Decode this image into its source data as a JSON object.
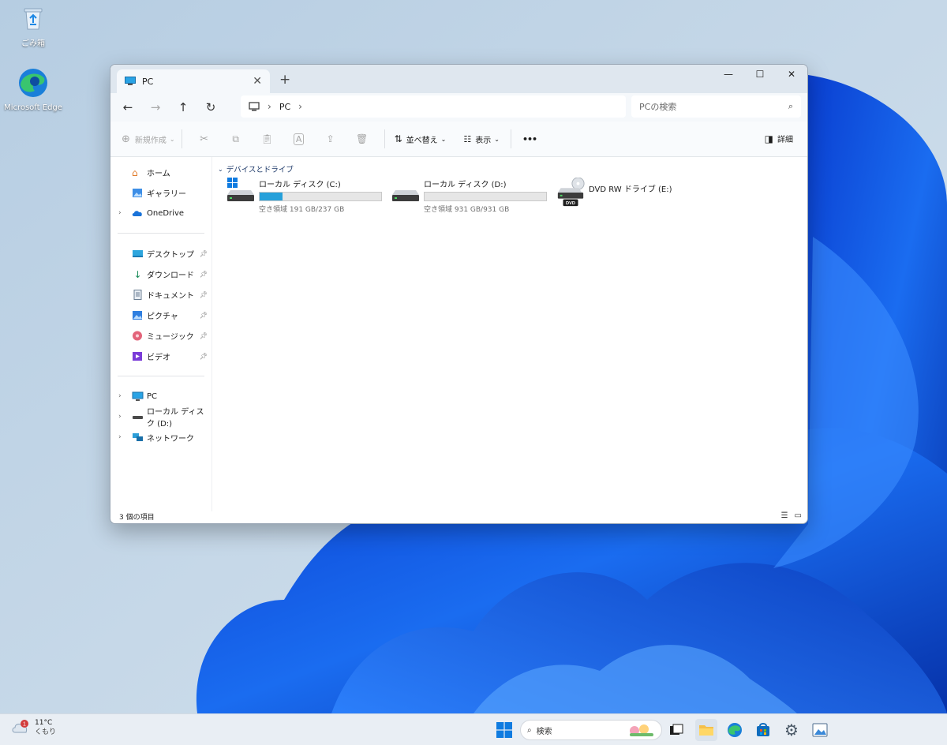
{
  "desktop": {
    "icons": [
      {
        "label": "ごみ箱"
      },
      {
        "label": "Microsoft Edge"
      }
    ]
  },
  "window": {
    "tab_title": "PC",
    "new_tab": "+",
    "address": {
      "crumbs": [
        "PC"
      ]
    },
    "search_placeholder": "PCの検索",
    "toolbar": {
      "new_label": "新規作成",
      "sort_label": "並べ替え",
      "view_label": "表示",
      "more_label": "•••",
      "details_label": "詳細"
    },
    "sidebar": {
      "home": "ホーム",
      "gallery": "ギャラリー",
      "onedrive": "OneDrive",
      "desktop": "デスクトップ",
      "downloads": "ダウンロード",
      "documents": "ドキュメント",
      "pictures": "ピクチャ",
      "music": "ミュージック",
      "videos": "ビデオ",
      "pc": "PC",
      "local_d": "ローカル ディスク (D:)",
      "network": "ネットワーク"
    },
    "content": {
      "group_header": "デバイスとドライブ",
      "drives": [
        {
          "name": "ローカル ディスク (C:)",
          "free_text": "空き領域 191 GB/237 GB",
          "used_fraction": 0.19
        },
        {
          "name": "ローカル ディスク (D:)",
          "free_text": "空き領域 931 GB/931 GB",
          "used_fraction": 0.0
        },
        {
          "name": "DVD RW ドライブ (E:)",
          "disc_label": "DVD"
        }
      ]
    },
    "status": "3 個の項目"
  },
  "taskbar": {
    "weather": {
      "temp": "11°C",
      "condition": "くもり",
      "badge": "1"
    },
    "search_label": "検索"
  },
  "colors": {
    "accent": "#26a0da",
    "folder_blue": "#0f6cbd"
  }
}
